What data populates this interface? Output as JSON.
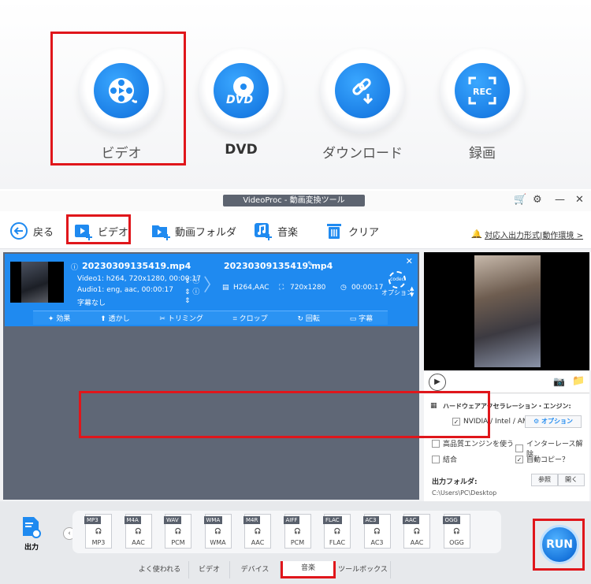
{
  "launcher": {
    "items": [
      {
        "label": "ビデオ",
        "icon": "film-reel-icon"
      },
      {
        "label": "DVD",
        "icon": "dvd-disc-icon"
      },
      {
        "label": "ダウンロード",
        "icon": "link-download-icon"
      },
      {
        "label": "録画",
        "icon": "rec-icon"
      }
    ]
  },
  "window": {
    "title": "VideoProc - 動画変換ツール",
    "controls": [
      "🛒",
      "⚙",
      "—",
      "✕"
    ]
  },
  "toolbar": {
    "back_label": "戻る",
    "video_label": "ビデオ",
    "folder_label": "動画フォルダ",
    "music_label": "音楽",
    "clear_label": "クリア",
    "notice_link": "対応入出力形式|動作環境 >"
  },
  "file": {
    "source_name": "20230309135419.mp4",
    "video_info": "Video1: h264, 720x1280, 00:00:17",
    "audio_info": "Audio1: eng, aac, 00:00:17",
    "subtitle_info": "字幕なし",
    "output_name": "20230309135419.mp4",
    "out_codec": "H264,AAC",
    "out_resolution": "720x1280",
    "out_duration": "00:00:17",
    "codec_option_label": "オプション",
    "codec_badge": "codec",
    "edit_tools": [
      "効果",
      "透かし",
      "トリミング",
      "クロップ",
      "回転",
      "字幕"
    ]
  },
  "settings": {
    "hw_title": "ハードウェアアクセラレーション・エンジン:",
    "hw_option": "NVIDIA / Intel / AMD",
    "option_button": "オプション",
    "high_quality": "高品質エンジンを使う",
    "deinterlace": "インターレース解除",
    "merge": "結合",
    "auto_copy": "自動コピー？",
    "output_folder_label": "出力フォルダ:",
    "browse_button": "参照",
    "open_button": "開く",
    "output_path": "C:\\Users\\PC\\Desktop"
  },
  "bottom": {
    "output_label": "出力",
    "formats": [
      {
        "tag": "MP3",
        "name": "MP3"
      },
      {
        "tag": "M4A",
        "name": "AAC"
      },
      {
        "tag": "WAV",
        "name": "PCM"
      },
      {
        "tag": "WMA",
        "name": "WMA"
      },
      {
        "tag": "M4R",
        "name": "AAC"
      },
      {
        "tag": "AIFF",
        "name": "PCM"
      },
      {
        "tag": "FLAC",
        "name": "FLAC"
      },
      {
        "tag": "AC3",
        "name": "AC3"
      },
      {
        "tag": "AAC",
        "name": "AAC"
      },
      {
        "tag": "OGG",
        "name": "OGG"
      }
    ],
    "tabs": [
      "よく使われる",
      "ビデオ",
      "デバイス",
      "音楽",
      "ツールボックス"
    ],
    "active_tab": "音楽",
    "run_label": "RUN"
  },
  "colors": {
    "accent": "#1f8af0",
    "highlight_box": "#e0161b",
    "panel_dark": "#5f6776"
  }
}
